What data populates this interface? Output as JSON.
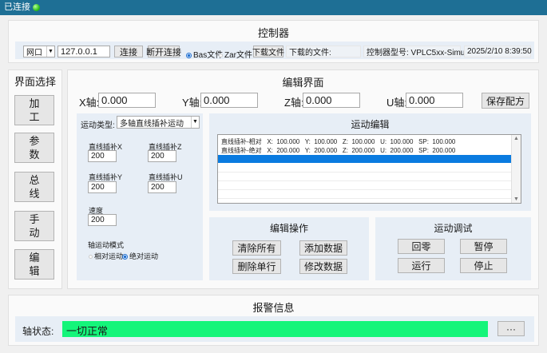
{
  "titlebar": {
    "status": "已连接"
  },
  "controller": {
    "title": "控制器",
    "conn_type": "网口",
    "ip": "127.0.0.1",
    "connect_label": "连接",
    "disconnect_label": "断开连接",
    "bas_file_label": "Bas文件",
    "zar_file_label": "Zar文件",
    "download_label": "下载文件",
    "downloaded_file_label": "下载的文件:",
    "model_label": "控制器型号: VPLC5xx-Simu",
    "datetime": "2025/2/10 8:39:50"
  },
  "nav": {
    "title": "界面选择",
    "items": [
      {
        "label_1": "加",
        "label_2": "工"
      },
      {
        "label_1": "参",
        "label_2": "数"
      },
      {
        "label_1": "总",
        "label_2": "线"
      },
      {
        "label_1": "手",
        "label_2": "动"
      },
      {
        "label_1": "编",
        "label_2": "辑"
      }
    ]
  },
  "editor": {
    "title": "编辑界面",
    "x_label": "X轴:",
    "x_value": "0.000",
    "y_label": "Y轴:",
    "y_value": "0.000",
    "z_label": "Z轴:",
    "z_value": "0.000",
    "u_label": "U轴:",
    "u_value": "0.000",
    "save_recipe_label": "保存配方",
    "motion_type_label": "运动类型:",
    "motion_type_value": "多轴直线插补运动",
    "interp_x_label": "直线插补X",
    "interp_x_value": "200",
    "interp_z_label": "直线插补Z",
    "interp_z_value": "200",
    "interp_y_label": "直线插补Y",
    "interp_y_value": "200",
    "interp_u_label": "直线插补U",
    "interp_u_value": "200",
    "speed_label": "速度",
    "speed_value": "200",
    "axis_mode_label": "轴运动模式",
    "relative_label": "相对运动",
    "absolute_label": "绝对运动"
  },
  "motion_edit": {
    "title": "运动编辑",
    "rows": [
      "直线插补-相对   X:  100.000   Y:  100.000   Z:  100.000   U:  100.000   SP:  100.000",
      "直线插补-绝对   X:  200.000   Y:  200.000   Z:  200.000   U:  200.000   SP:  200.000"
    ]
  },
  "edit_ops": {
    "title": "编辑操作",
    "clear_all": "清除所有",
    "add_data": "添加数据",
    "delete_row": "删除单行",
    "modify_data": "修改数据"
  },
  "motion_debug": {
    "title": "运动调试",
    "home": "回零",
    "pause": "暂停",
    "run": "运行",
    "stop": "停止"
  },
  "alarm": {
    "title": "报警信息",
    "axis_status_label": "轴状态:",
    "axis_status_value": "一切正常",
    "more_label": "···"
  }
}
